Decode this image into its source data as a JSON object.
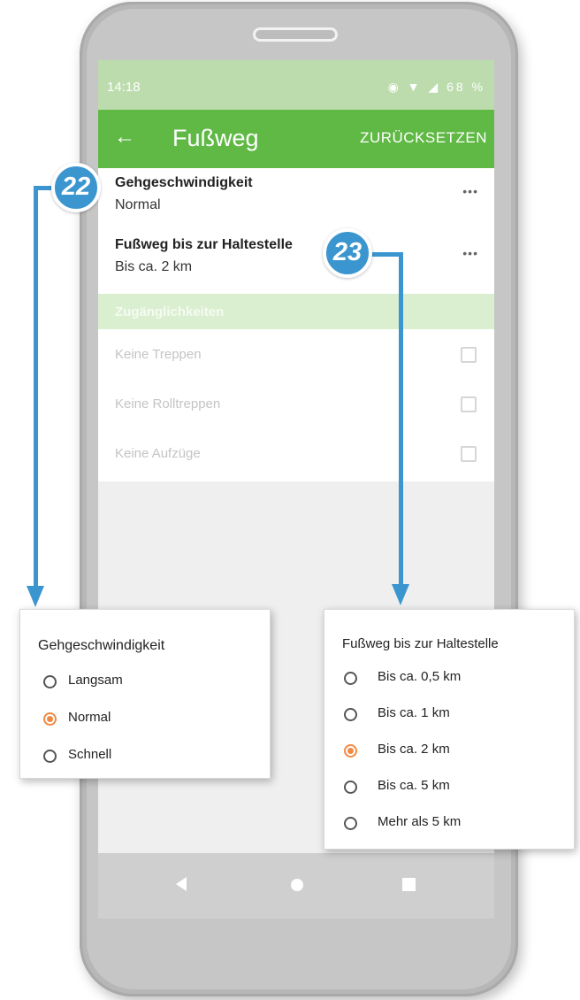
{
  "status_bar": {
    "time": "14:18",
    "battery": "68 %"
  },
  "toolbar": {
    "back_icon": "arrow-left-icon",
    "title": "Fußweg",
    "reset_label": "ZURÜCKSETZEN"
  },
  "preferences": [
    {
      "title": "Gehgeschwindigkeit",
      "value": "Normal",
      "menu_icon": "more-horizontal-icon"
    },
    {
      "title": "Fußweg bis zur Haltestelle",
      "value": "Bis ca. 2 km",
      "menu_icon": "more-horizontal-icon"
    }
  ],
  "accessibility": {
    "header": "Zugänglichkeiten",
    "items": [
      {
        "label": "Keine Treppen",
        "checked": false
      },
      {
        "label": "Keine Rolltreppen",
        "checked": false
      },
      {
        "label": "Keine Aufzüge",
        "checked": false
      }
    ]
  },
  "callouts": {
    "speed": "22",
    "distance": "23"
  },
  "speed_dialog": {
    "title": "Gehgeschwindigkeit",
    "options": [
      {
        "label": "Langsam",
        "selected": false
      },
      {
        "label": "Normal",
        "selected": true
      },
      {
        "label": "Schnell",
        "selected": false
      }
    ]
  },
  "distance_dialog": {
    "title": "Fußweg bis zur Haltestelle",
    "options": [
      {
        "label": "Bis ca. 0,5 km",
        "selected": false
      },
      {
        "label": "Bis ca. 1 km",
        "selected": false
      },
      {
        "label": "Bis ca. 2 km",
        "selected": true
      },
      {
        "label": "Bis ca. 5 km",
        "selected": false
      },
      {
        "label": "Mehr als 5 km",
        "selected": false
      }
    ]
  },
  "colors": {
    "toolbar": "#5fb944",
    "accent_radio": "#f08a43",
    "callout": "#3b96cf"
  }
}
